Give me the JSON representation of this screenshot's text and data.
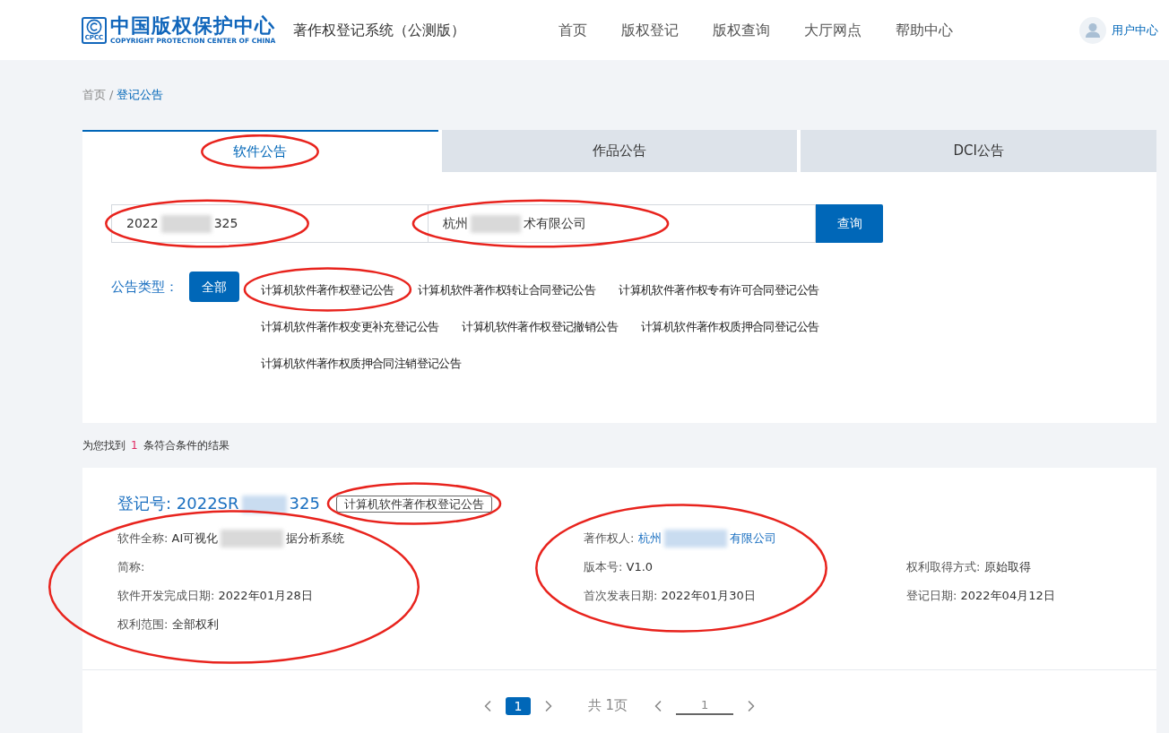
{
  "header": {
    "logo": {
      "name": "中国版权保护中心",
      "subtitle": "COPYRIGHT PROTECTION CENTER OF CHINA",
      "badge": "CPCC"
    },
    "system_title": "著作权登记系统（公测版）",
    "nav": [
      {
        "label": "首页",
        "selected": false
      },
      {
        "label": "版权登记",
        "selected": false
      },
      {
        "label": "版权查询",
        "selected": false
      },
      {
        "label": "大厅网点",
        "selected": false
      },
      {
        "label": "帮助中心",
        "selected": false
      }
    ],
    "user": "用户中心"
  },
  "breadcrumb": [
    {
      "label": "首页",
      "current": false
    },
    {
      "label": "登记公告",
      "current": true
    }
  ],
  "breadcrumb_separator": "/",
  "tabs": [
    {
      "label": "软件公告",
      "selected": true,
      "circled": true
    },
    {
      "label": "作品公告",
      "selected": false
    },
    {
      "label": "DCI公告",
      "selected": false
    }
  ],
  "search": {
    "fields": [
      {
        "value_start": "2022",
        "value_end": "325",
        "circled": true
      },
      {
        "value_start": "杭州",
        "value_end": "术有限公司",
        "circled": true
      }
    ],
    "button": "查询"
  },
  "filter": {
    "label": "公告类型：",
    "all": {
      "label": "全部",
      "selected": true
    },
    "types": [
      {
        "label": "计算机软件著作权登记公告",
        "circled": true
      },
      {
        "label": "计算机软件著作权转让合同登记公告"
      },
      {
        "label": "计算机软件著作权专有许可合同登记公告"
      },
      {
        "label": "计算机软件著作权变更补充登记公告"
      },
      {
        "label": "计算机软件著作权登记撤销公告"
      },
      {
        "label": "计算机软件著作权质押合同登记公告"
      },
      {
        "label": "计算机软件著作权质押合同注销登记公告"
      }
    ]
  },
  "result_summary": {
    "before": "为您找到",
    "count": "1",
    "after": "条符合条件的结果"
  },
  "result": {
    "number_start": "登记号: 2022SR",
    "number_end": "325",
    "tag": "计算机软件著作权登记公告",
    "tag_circled": true,
    "columns": [
      {
        "circled": true,
        "fields": [
          {
            "kind": "field",
            "label": "软件全称:",
            "value_start": "AI可视化",
            "value_end": "据分析系统",
            "redacted": true,
            "link": false
          },
          {
            "kind": "field",
            "label": "简称:",
            "redacted": false
          },
          {
            "kind": "field",
            "label": "软件开发完成日期:",
            "value_start": "2022年01月28日",
            "redacted": false,
            "link": false
          },
          {
            "kind": "field",
            "label": "权利范围:",
            "value_start": "全部权利",
            "redacted": false,
            "link": false
          }
        ]
      },
      {
        "circled": true,
        "fields": [
          {
            "kind": "field",
            "label": "著作权人:",
            "value_start": "杭州",
            "value_end": "有限公司",
            "redacted": true,
            "link": true
          },
          {
            "kind": "field",
            "label": "版本号:",
            "value_start": "V1.0",
            "redacted": false,
            "link": false
          },
          {
            "kind": "field",
            "label": "首次发表日期:",
            "value_start": "2022年01月30日",
            "redacted": false,
            "link": false
          }
        ]
      },
      {
        "fields": [
          {
            "kind": "blank"
          },
          {
            "kind": "field",
            "label": "权利取得方式:",
            "value_start": "原始取得",
            "redacted": false,
            "link": false
          },
          {
            "kind": "field",
            "label": "登记日期:",
            "value_start": "2022年04月12日",
            "redacted": false,
            "link": false
          }
        ]
      }
    ]
  },
  "pagination": {
    "pages": [
      {
        "label": "1",
        "selected": true
      }
    ],
    "total": "共 1页",
    "jump_value": "1"
  }
}
